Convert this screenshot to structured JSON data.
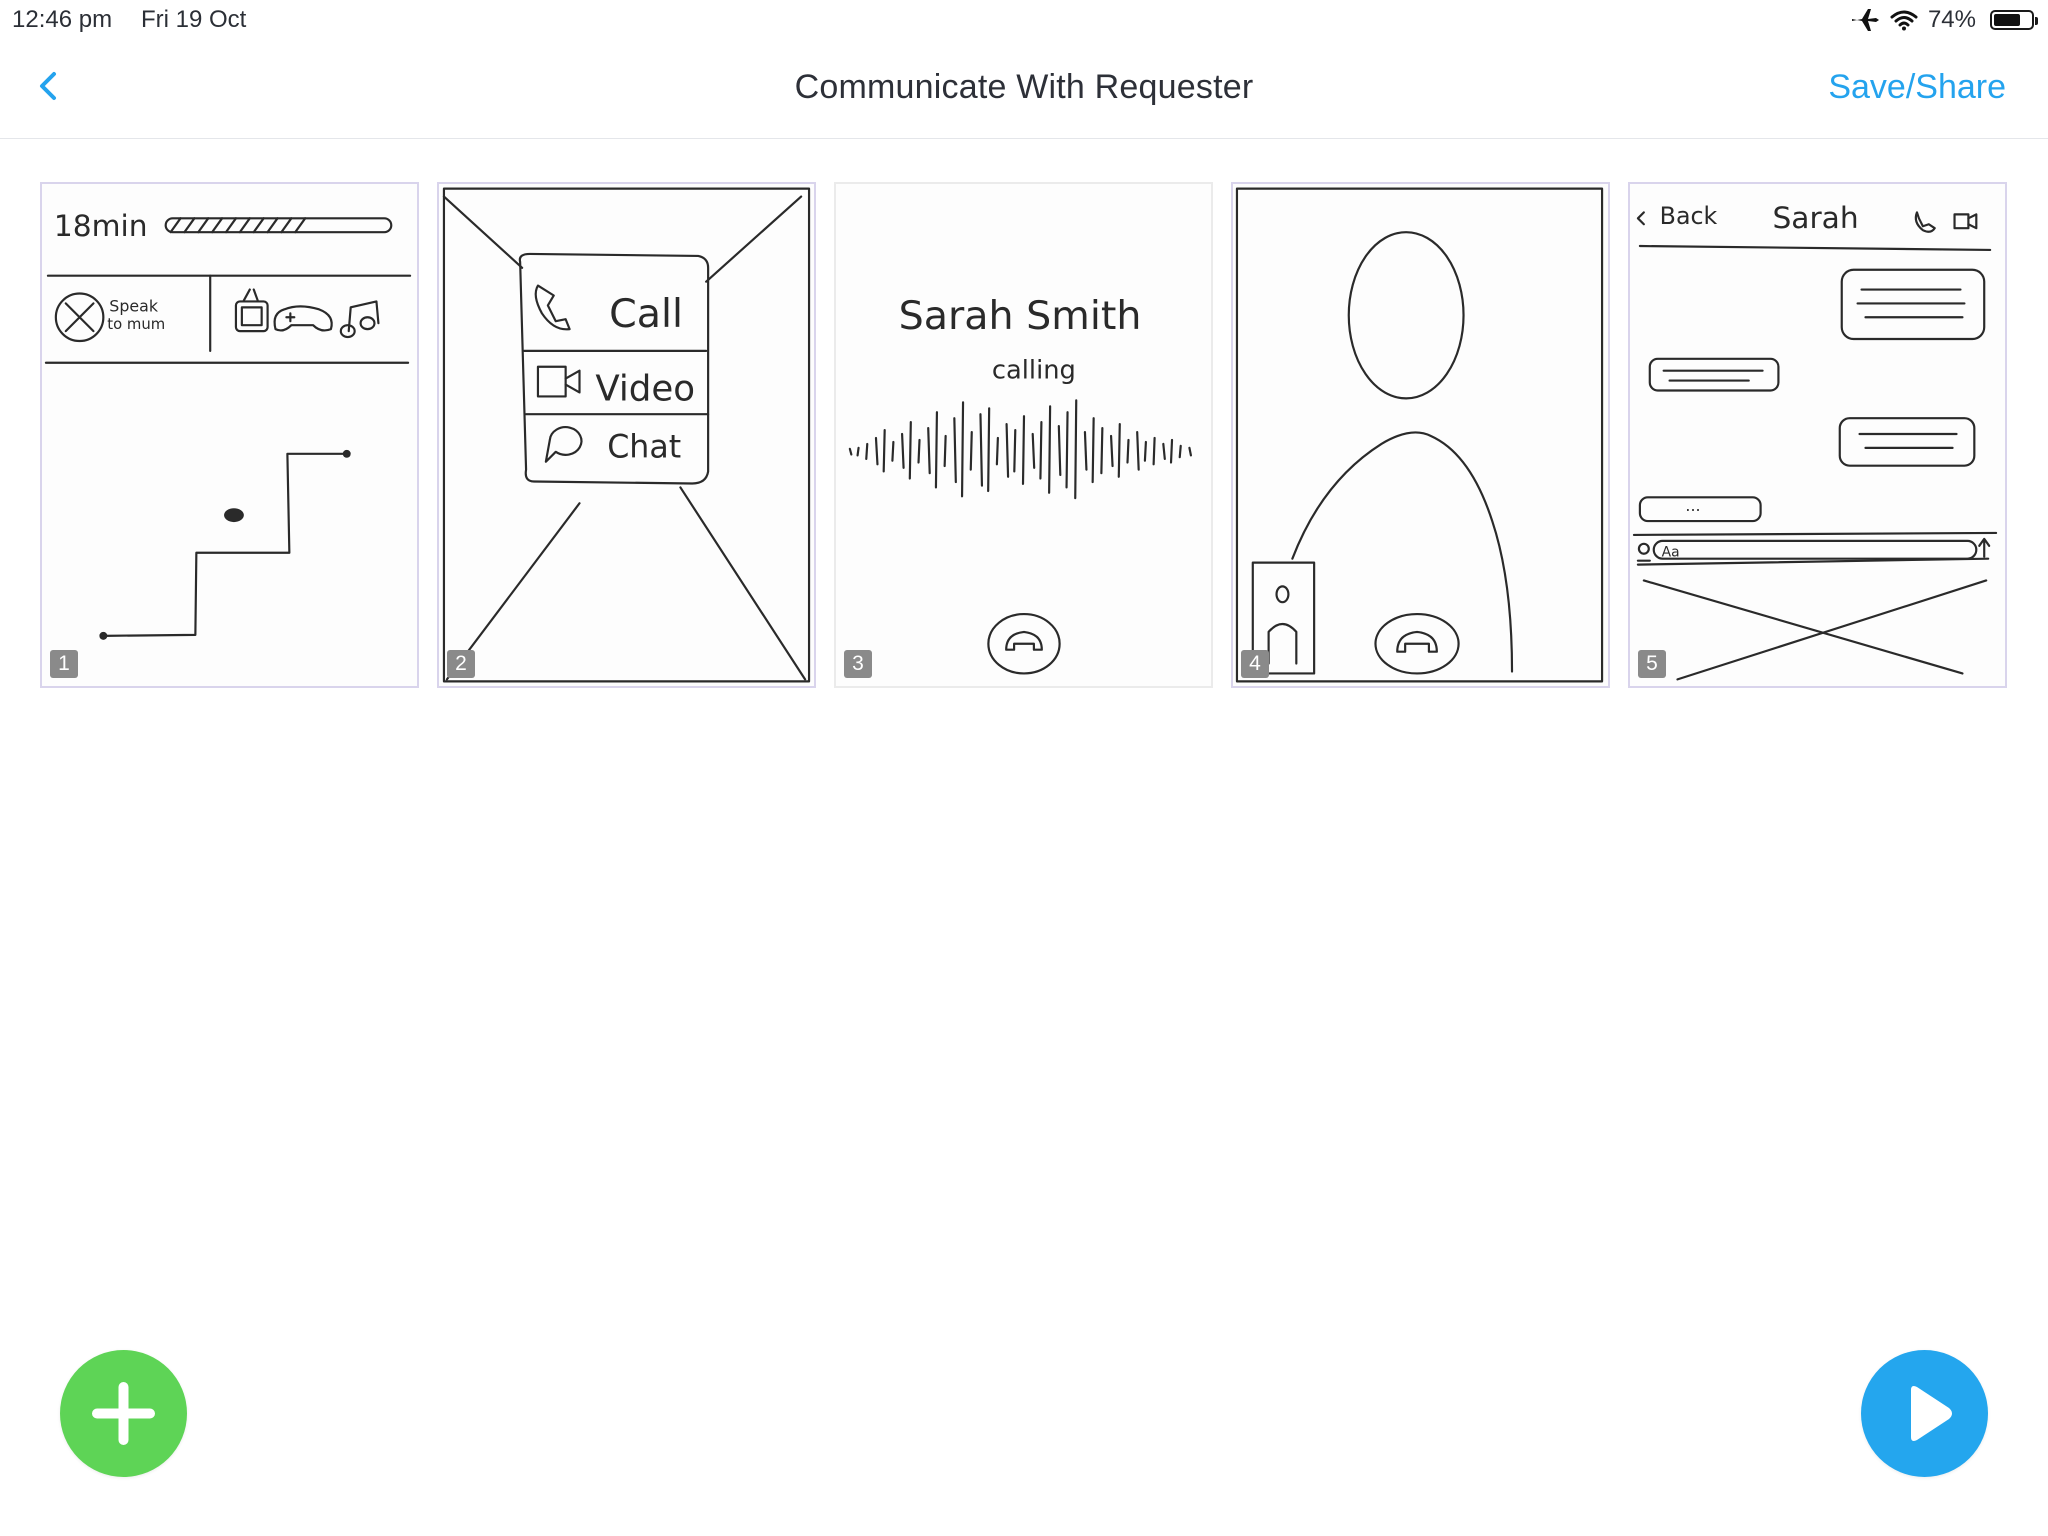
{
  "status_bar": {
    "time": "12:46 pm",
    "date": "Fri 19 Oct",
    "battery_percent": "74%",
    "battery_level": 0.74,
    "icons": [
      "airplane-icon",
      "wifi-icon",
      "battery-icon"
    ]
  },
  "nav": {
    "back_icon": "chevron-left-icon",
    "title": "Communicate With Requester",
    "action_label": "Save/Share"
  },
  "storyboard": {
    "cards": [
      {
        "number": "1",
        "sketch": {
          "time_label": "18min",
          "speak_label_line1": "Speak",
          "speak_label_line2": "to mum"
        }
      },
      {
        "number": "2",
        "sketch": {
          "call_label": "Call",
          "video_label": "Video",
          "chat_label": "Chat"
        }
      },
      {
        "number": "3",
        "sketch": {
          "caller_name": "Sarah Smith",
          "status": "calling"
        }
      },
      {
        "number": "4",
        "sketch": {}
      },
      {
        "number": "5",
        "sketch": {
          "back_label": "Back",
          "contact_name": "Sarah",
          "input_placeholder": "Aa",
          "typing_dots": "..."
        }
      }
    ]
  },
  "actions": {
    "add_icon": "plus-icon",
    "play_icon": "play-icon"
  },
  "colors": {
    "accent_blue": "#24a3ee",
    "add_green": "#5ed456",
    "card_border": "#d9d4ec"
  }
}
